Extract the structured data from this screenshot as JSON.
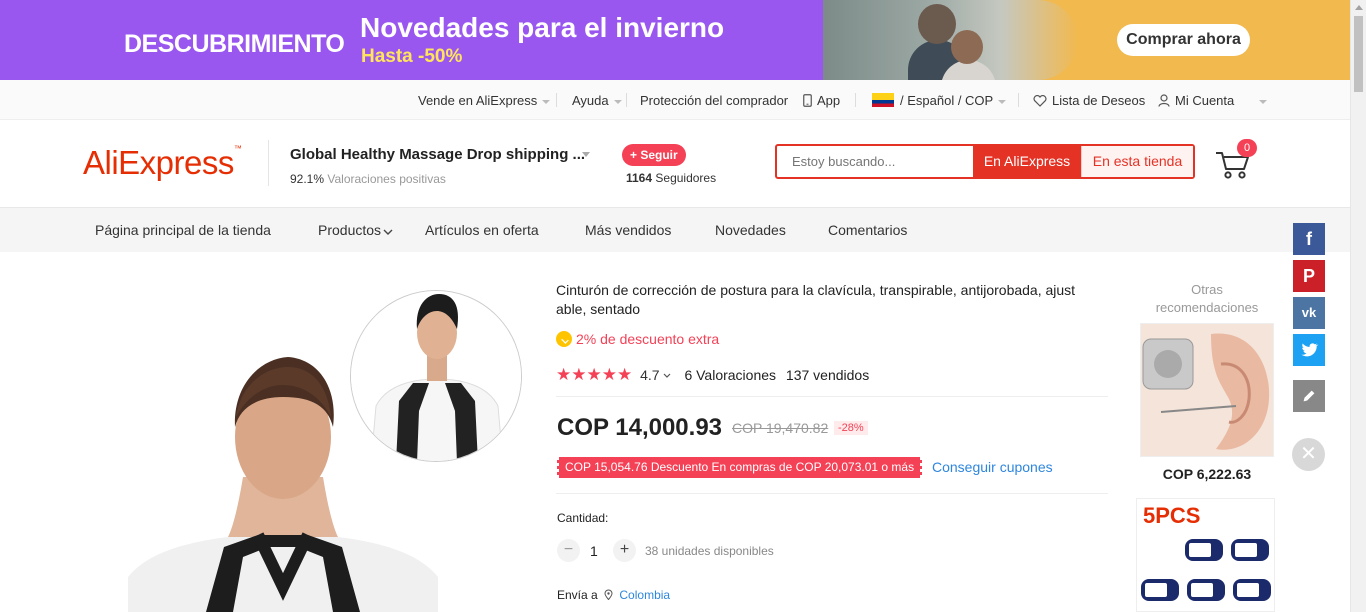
{
  "banner": {
    "left_tag": "DESCUBRIMIENTO",
    "title": "Novedades para el invierno",
    "discount": "Hasta -50%",
    "cta": "Comprar ahora"
  },
  "topnav": {
    "sell": "Vende en AliExpress",
    "help": "Ayuda",
    "protection": "Protección del comprador",
    "app": "App",
    "locale": "/ Español /  COP",
    "wishlist": "Lista de Deseos",
    "account": "Mi Cuenta"
  },
  "header": {
    "logo": "AliExpress",
    "store_name": "Global Healthy Massage Drop shipping ...",
    "rating_pct": "92.1%",
    "rating_label": "Valoraciones positivas",
    "follow": "+ Seguir",
    "followers_count": "1164",
    "followers_label": "Seguidores",
    "search_placeholder": "Estoy buscando...",
    "search_btn_all": "En AliExpress",
    "search_btn_store": "En esta tienda",
    "cart_count": "0"
  },
  "storenav": {
    "items": [
      "Página principal de la tienda",
      "Productos",
      "Artículos en oferta",
      "Más vendidos",
      "Novedades",
      "Comentarios"
    ]
  },
  "product": {
    "title": "Cinturón de corrección de postura para la clavícula, transpirable, antijorobada, ajust able, sentado",
    "extra_discount": "2% de descuento extra",
    "rating": "4.7",
    "reviews": "6 Valoraciones",
    "sold": "137 vendidos",
    "price": "COP 14,000.93",
    "old_price": "COP 19,470.82",
    "discount_pct": "-28%",
    "coupon": "COP 15,054.76 Descuento En compras de COP 20,073.01 o más",
    "get_coupons": "Conseguir cupones",
    "qty_label": "Cantidad:",
    "qty": "1",
    "available": "38 unidades disponibles",
    "ship_to": "Envía a",
    "country": "Colombia"
  },
  "recommendations": {
    "title": "Otras recomendaciones",
    "item1_price": "COP 6,222.63",
    "item2_tag": "5PCS"
  },
  "colors": {
    "accent": "#e43225",
    "brand": "#e62e04",
    "banner": "#9a57f0"
  }
}
